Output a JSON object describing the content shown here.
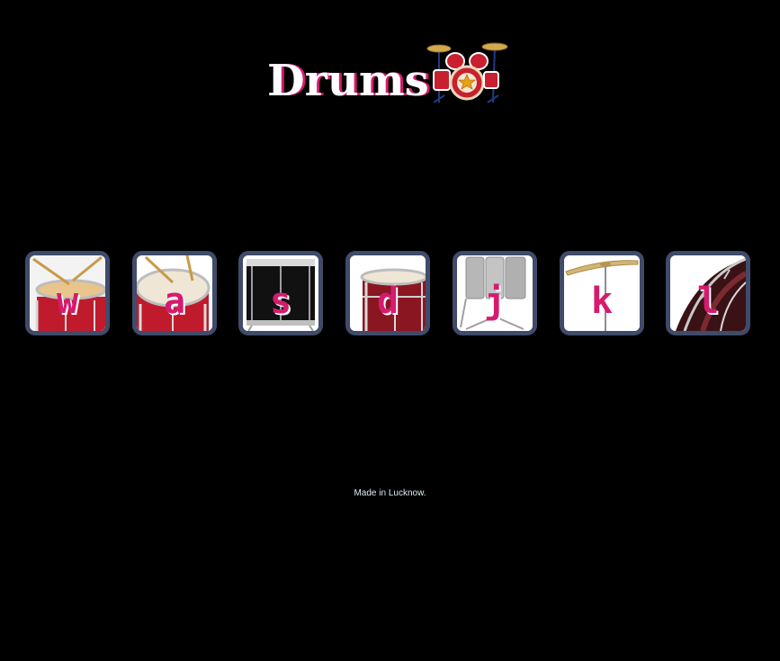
{
  "header": {
    "title": "Drums",
    "icon": "drum-kit-icon"
  },
  "drums": [
    {
      "key": "w",
      "instrument": "tom-1-icon"
    },
    {
      "key": "a",
      "instrument": "tom-2-icon"
    },
    {
      "key": "s",
      "instrument": "tom-3-icon"
    },
    {
      "key": "d",
      "instrument": "tom-4-icon"
    },
    {
      "key": "j",
      "instrument": "snare-icon"
    },
    {
      "key": "k",
      "instrument": "crash-cymbal-icon"
    },
    {
      "key": "l",
      "instrument": "kick-drum-icon"
    }
  ],
  "footer": {
    "text": "Made in Lucknow."
  },
  "colors": {
    "background": "#000000",
    "accent": "#d61b6f",
    "button_border": "#404b69",
    "footer_text": "#dbedf3"
  }
}
